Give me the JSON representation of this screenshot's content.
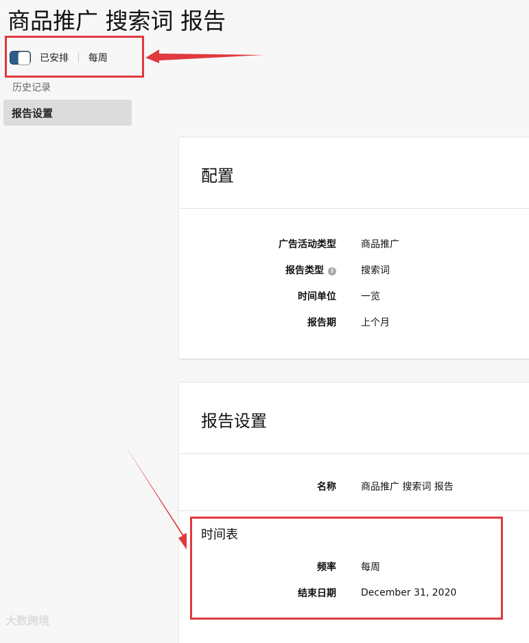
{
  "title": "商品推广 搜索词 报告",
  "status": {
    "scheduled": "已安排",
    "frequency": "每周"
  },
  "nav": {
    "history": "历史记录",
    "settings": "报告设置"
  },
  "config": {
    "heading": "配置",
    "rows": [
      {
        "label": "广告活动类型",
        "value": "商品推广"
      },
      {
        "label": "报告类型",
        "value": "搜索词"
      },
      {
        "label": "时间单位",
        "value": "一览"
      },
      {
        "label": "报告期",
        "value": "上个月"
      }
    ]
  },
  "report_settings": {
    "heading": "报告设置",
    "name_label": "名称",
    "name_value": "商品推广 搜索词 报告",
    "schedule": {
      "heading": "时间表",
      "freq_label": "频率",
      "freq_value": "每周",
      "end_label": "结束日期",
      "end_value": "December 31, 2020"
    }
  },
  "watermark": "大数跨境",
  "colors": {
    "toggle": "#2e5a8c",
    "annotation": "#e0393e"
  }
}
